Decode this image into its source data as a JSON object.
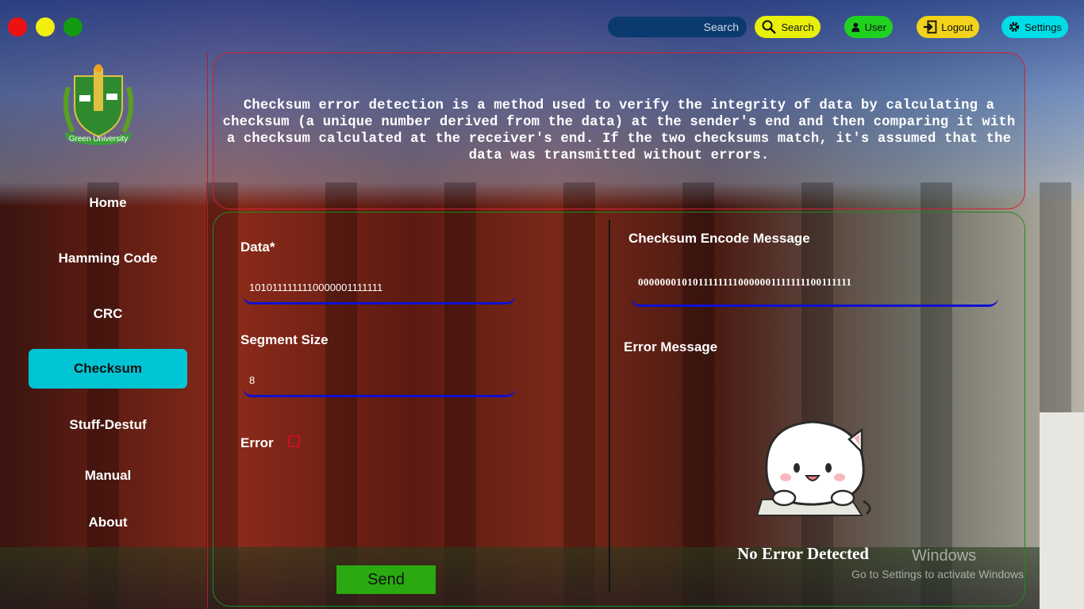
{
  "window_controls": [
    "close",
    "minimize",
    "maximize"
  ],
  "topbar": {
    "search_placeholder": "Search",
    "search_button": "Search",
    "user_button": "User",
    "logout_button": "Logout",
    "settings_button": "Settings"
  },
  "logo": {
    "text": "Green University"
  },
  "nav": {
    "items": [
      {
        "label": "Home",
        "active": false
      },
      {
        "label": "Hamming Code",
        "active": false
      },
      {
        "label": "CRC",
        "active": false
      },
      {
        "label": "Checksum",
        "active": true
      },
      {
        "label": "Stuff-Destuf",
        "active": false
      },
      {
        "label": "Manual",
        "active": false
      },
      {
        "label": "About",
        "active": false
      }
    ]
  },
  "info": {
    "text": "Checksum error detection is a method used to verify the integrity of data by calculating a checksum (a unique number derived from the data) at the sender's end and then comparing it with a checksum calculated at the receiver's end. If the two checksums match, it's assumed that the data was transmitted without errors."
  },
  "form": {
    "data_label": "Data*",
    "data_value": "1010111111110000001111111",
    "segment_label": "Segment Size",
    "segment_value": "8",
    "error_label": "Error",
    "error_checked": false,
    "send_label": "Send"
  },
  "output": {
    "encode_label": "Checksum Encode Message",
    "encode_value": "00000001010111111110000001111111100111111",
    "error_label": "Error Message",
    "result_text": "No Error Detected"
  },
  "watermark": {
    "line1": "Windows",
    "line2": "Go to Settings to activate Windows"
  },
  "colors": {
    "nav_active": "#00c4d4",
    "search_btn": "#e8f00a",
    "user_btn": "#20d220",
    "logout_btn": "#f2d21a",
    "settings_btn": "#00dde6",
    "send_btn": "#2aaa10",
    "info_border": "#d12030",
    "form_border": "#1f8a20",
    "field_underline": "#1010d0"
  }
}
